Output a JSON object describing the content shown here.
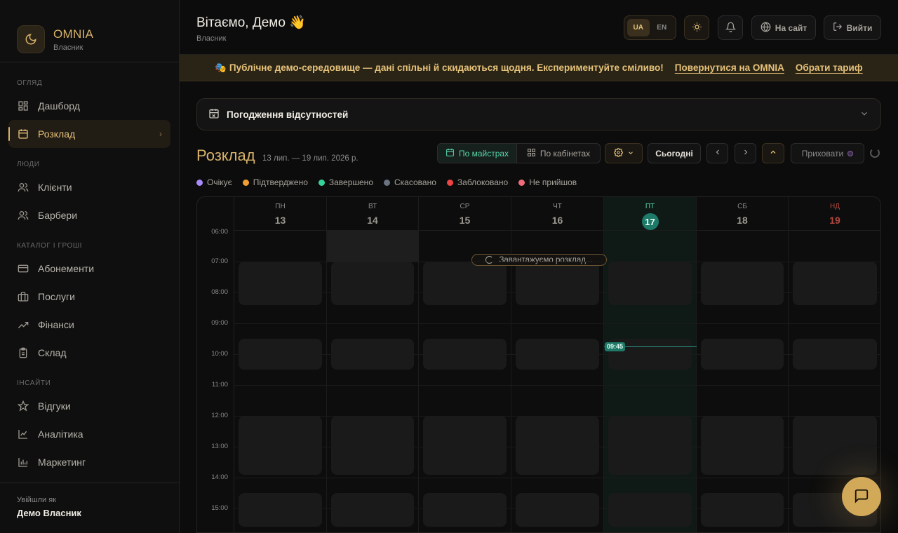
{
  "brand": {
    "title": "OMNIA",
    "subtitle": "Власник"
  },
  "sidebar": {
    "sections": [
      {
        "label": "ОГЛЯД",
        "items": [
          {
            "label": "Дашборд",
            "icon": "dashboard-icon"
          },
          {
            "label": "Розклад",
            "icon": "calendar-icon",
            "active": true
          }
        ]
      },
      {
        "label": "ЛЮДИ",
        "items": [
          {
            "label": "Клієнти",
            "icon": "users-icon"
          },
          {
            "label": "Барбери",
            "icon": "users-icon"
          }
        ]
      },
      {
        "label": "КАТАЛОГ І ГРОШІ",
        "items": [
          {
            "label": "Абонементи",
            "icon": "card-icon"
          },
          {
            "label": "Послуги",
            "icon": "briefcase-icon"
          },
          {
            "label": "Фінанси",
            "icon": "trend-icon"
          },
          {
            "label": "Склад",
            "icon": "clipboard-icon"
          }
        ]
      },
      {
        "label": "ІНСАЙТИ",
        "items": [
          {
            "label": "Відгуки",
            "icon": "star-icon"
          },
          {
            "label": "Аналітика",
            "icon": "line-chart-icon"
          },
          {
            "label": "Маркетинг",
            "icon": "bar-chart-icon"
          }
        ]
      }
    ],
    "footer": {
      "label": "Увійшли як",
      "name": "Демо Власник"
    }
  },
  "header": {
    "greeting": "Вітаємо, Демо 👋",
    "role": "Власник",
    "lang_ua": "UA",
    "lang_en": "EN",
    "site_label": "На сайт",
    "logout_label": "Вийти"
  },
  "banner": {
    "message": "🎭 Публічне демо-середовище — дані спільні й скидаються щодня. Експериментуйте сміливо!",
    "link_back": "Повернутися на OMNIA",
    "link_plan": "Обрати тариф"
  },
  "absence": {
    "title": "Погодження відсутностей"
  },
  "schedule": {
    "title": "Розклад",
    "range": "13 лип. — 19 лип. 2026 р.",
    "by_masters": "По майстрах",
    "by_rooms": "По кабінетах",
    "today": "Сьогодні",
    "hide": "Приховати",
    "loading": "Завантажуємо розклад...",
    "now_time": "09:45"
  },
  "legend": [
    {
      "label": "Очікує",
      "color": "#a78bfa"
    },
    {
      "label": "Підтверджено",
      "color": "#f0a030"
    },
    {
      "label": "Завершено",
      "color": "#34d399"
    },
    {
      "label": "Скасовано",
      "color": "#6b7280"
    },
    {
      "label": "Заблоковано",
      "color": "#ef4444"
    },
    {
      "label": "Не прийшов",
      "color": "#f06a7a"
    }
  ],
  "days": [
    {
      "name": "ПН",
      "num": "13"
    },
    {
      "name": "ВТ",
      "num": "14"
    },
    {
      "name": "СР",
      "num": "15"
    },
    {
      "name": "ЧТ",
      "num": "16"
    },
    {
      "name": "ПТ",
      "num": "17",
      "today": true
    },
    {
      "name": "СБ",
      "num": "18"
    },
    {
      "name": "НД",
      "num": "19",
      "sunday": true
    }
  ],
  "times": [
    "06:00",
    "07:00",
    "08:00",
    "09:00",
    "10:00",
    "11:00",
    "12:00",
    "13:00",
    "14:00",
    "15:00"
  ]
}
